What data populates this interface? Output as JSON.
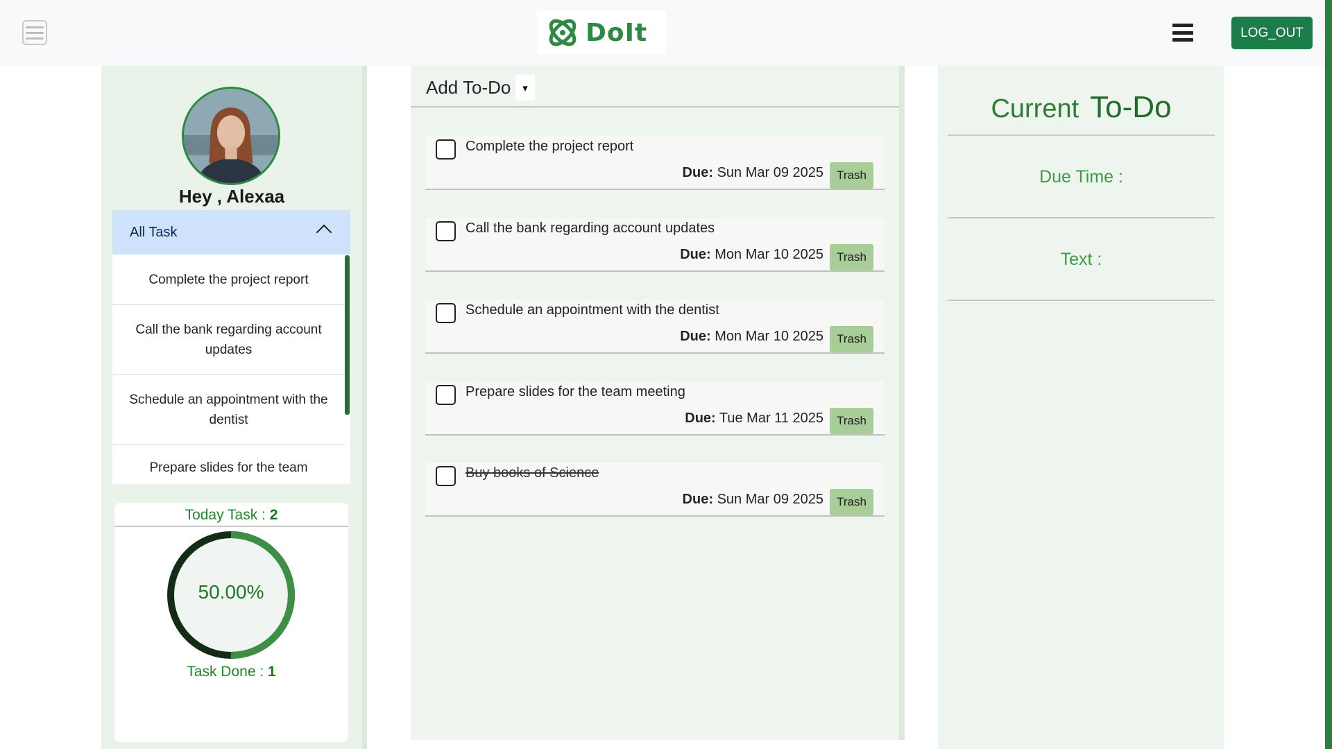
{
  "header": {
    "logo_text": "DoIt",
    "logout_label": "LOG_OUT",
    "brand_color": "#2c8a45",
    "logout_color": "#1c7c4a"
  },
  "sidebar": {
    "greeting": "Hey , Alexaa",
    "accordion_title": "All Task",
    "task_list": [
      "Complete the project report",
      "Call the bank regarding account updates",
      "Schedule an appointment with the dentist",
      "Prepare slides for the team"
    ],
    "stats": {
      "today_label": "Today Task : ",
      "today_count": "2",
      "progress_text": "50.00%",
      "progress_fraction": 0.5,
      "done_label": "Task Done : ",
      "done_count": "1"
    }
  },
  "main": {
    "add_todo_label": "Add To-Do",
    "add_todo_caret": "▾",
    "due_label": "Due:",
    "trash_label": "Trash",
    "todos": [
      {
        "text": "Complete the project report",
        "due": "Sun Mar 09 2025",
        "done": false
      },
      {
        "text": "Call the bank regarding account updates",
        "due": "Mon Mar 10 2025",
        "done": false
      },
      {
        "text": "Schedule an appointment with the dentist",
        "due": "Mon Mar 10 2025",
        "done": false
      },
      {
        "text": "Prepare slides for the team meeting",
        "due": "Tue Mar 11 2025",
        "done": false
      },
      {
        "text": "Buy books of Science",
        "due": "Sun Mar 09 2025",
        "done": true
      }
    ]
  },
  "details": {
    "title_part1": "Current",
    "title_part2": "To-Do",
    "due_time_label": "Due Time :",
    "text_label": "Text :"
  }
}
